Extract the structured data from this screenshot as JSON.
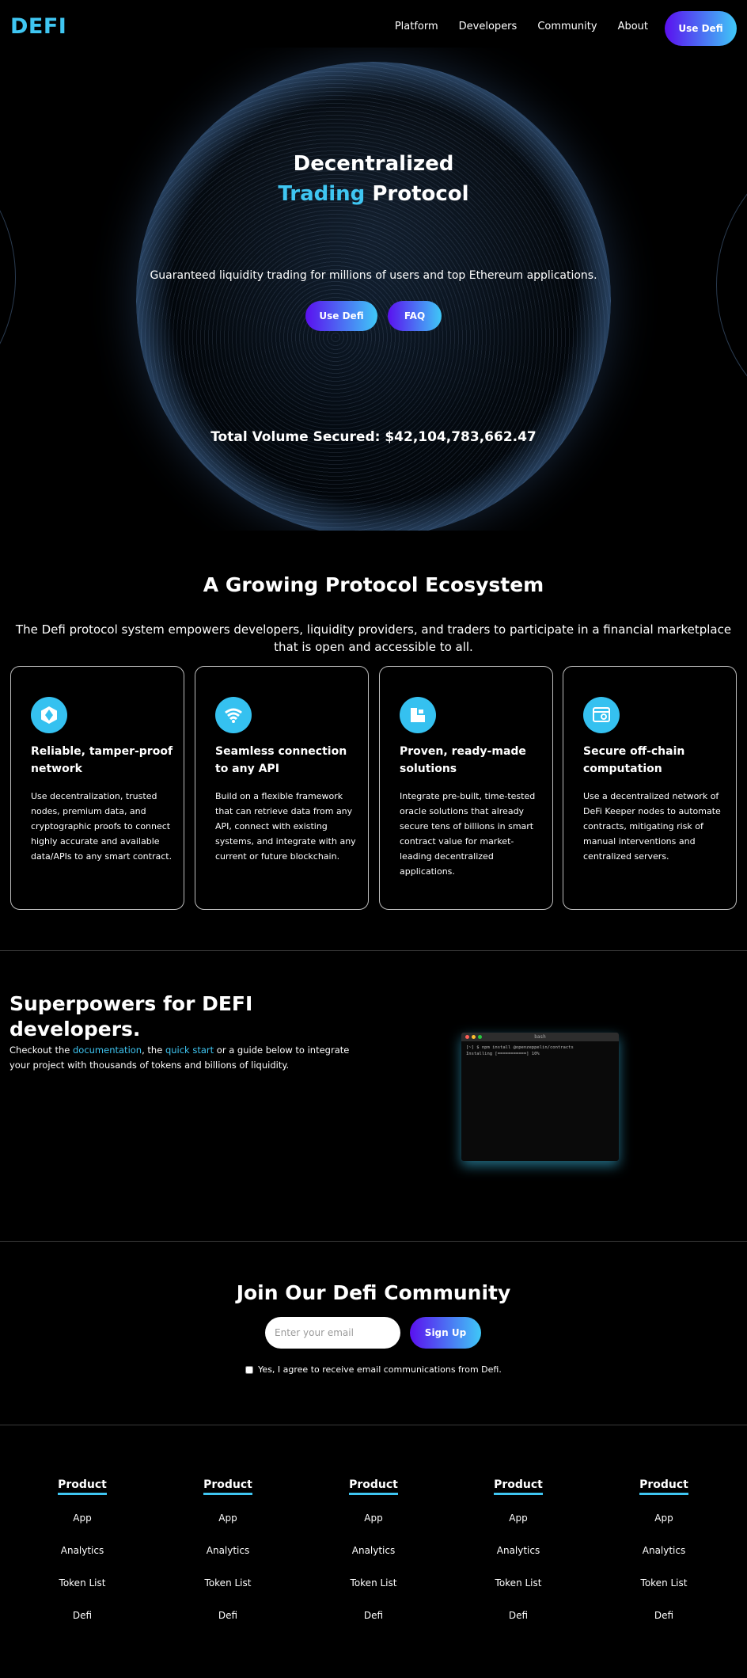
{
  "nav": {
    "logo": "DEFI",
    "links": [
      "Platform",
      "Developers",
      "Community",
      "About"
    ],
    "cta": "Use Defi"
  },
  "hero": {
    "title_line1": "Decentralized",
    "title_accent": "Trading",
    "title_rest": " Protocol",
    "subtitle": "Guaranteed liquidity trading for millions of users and top Ethereum applications.",
    "primary_button": "Use Defi",
    "secondary_button": "FAQ",
    "total_volume": "Total Volume Secured: $42,104,783,662.47"
  },
  "ecosystem": {
    "title": "A Growing Protocol Ecosystem",
    "description": "The Defi protocol system empowers developers, liquidity providers, and traders to participate in a financial marketplace that is open and accessible to all.",
    "cards": [
      {
        "icon": "hexagon-diamond-icon",
        "title": "Reliable, tamper-proof network",
        "text": "Use decentralization, trusted nodes, premium data, and cryptographic proofs to connect highly accurate and available data/APIs to any smart contract."
      },
      {
        "icon": "wifi-signal-icon",
        "title": "Seamless connection to any API",
        "text": "Build on a flexible framework that can retrieve data from any API, connect with existing systems, and integrate with any current or future blockchain."
      },
      {
        "icon": "blocks-icon",
        "title": "Proven, ready-made solutions",
        "text": "Integrate pre-built, time-tested oracle solutions that already secure tens of billions in smart contract value for market-leading decentralized applications."
      },
      {
        "icon": "browser-gear-icon",
        "title": "Secure off-chain computation",
        "text": "Use a decentralized network of DeFi Keeper nodes to automate contracts, mitigating risk of manual interventions and centralized servers."
      }
    ]
  },
  "developers": {
    "title": "Superpowers for DEFI developers.",
    "desc_prefix": "Checkout the ",
    "link_docs": "documentation",
    "desc_mid": ", the ",
    "link_quickstart": "quick start",
    "desc_suffix": " or a guide below to integrate your project with thousands of tokens and billions of liquidity.",
    "terminal": {
      "title": "bash",
      "line1": "[~] $ npm install @openzeppelin/contracts",
      "line2": "Installing [===========] 10%"
    }
  },
  "community": {
    "title": "Join Our Defi Community",
    "email_placeholder": "Enter your email",
    "signup": "Sign Up",
    "agree": "Yes, I agree to receive email communications from Defi."
  },
  "footer": {
    "columns": [
      {
        "title": "Product",
        "links": [
          "App",
          "Analytics",
          "Token List",
          "Defi"
        ]
      },
      {
        "title": "Product",
        "links": [
          "App",
          "Analytics",
          "Token List",
          "Defi"
        ]
      },
      {
        "title": "Product",
        "links": [
          "App",
          "Analytics",
          "Token List",
          "Defi"
        ]
      },
      {
        "title": "Product",
        "links": [
          "App",
          "Analytics",
          "Token List",
          "Defi"
        ]
      },
      {
        "title": "Product",
        "links": [
          "App",
          "Analytics",
          "Token List",
          "Defi"
        ]
      }
    ]
  },
  "colors": {
    "accent": "#3fc6f2",
    "gradient_start": "#5a10ef",
    "gradient_end": "#3fc8f7",
    "background": "#000000"
  }
}
